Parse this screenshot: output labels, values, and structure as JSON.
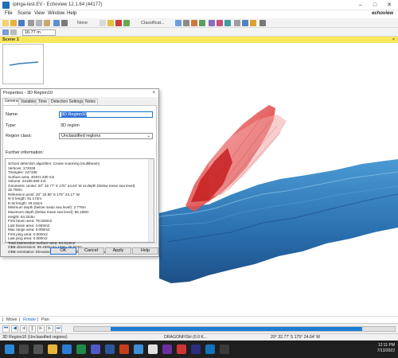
{
  "window": {
    "title": "ipinga-test.EV - Echoview 12.1.64 (44177)"
  },
  "brand": "echoview",
  "menu": [
    "File",
    "Scene",
    "View",
    "Window",
    "Help"
  ],
  "toolbar": {
    "none_label": "None",
    "classification_label": "Classificat..."
  },
  "coord_field": {
    "value": "16.77  m"
  },
  "scene": {
    "tab_label": "Scene 1",
    "close": "×"
  },
  "dialog": {
    "title": "Properties - 3D Region10",
    "close": "×",
    "tabs": [
      "General",
      "Variables",
      "Time",
      "Detection Settings",
      "Notes"
    ],
    "active_tab": "General",
    "name_label": "Name:",
    "name_value": "3D Region10",
    "type_label": "Type:",
    "type_value": "3D region",
    "class_label": "Region class:",
    "class_value": "Unclassified regions",
    "further_label": "Further information:",
    "info_lines": [
      "School detection algorithm: Cruise scanning (multibeam)",
      "Vertices: 172028",
      "Triangles: 247336",
      "Surface area:  40401.330 m2",
      "Volume:  22186.609 m3",
      "Geometric center: 20° 32.77' S 175° 24.64' W at depth (below mean sea level):",
      "32.760m",
      "Reference point: 20° 32.90' S 175° 24.17' W",
      "N-S length:   91.172m",
      "E-W length:   49.162m",
      "Minimum depth (below mean sea level):     2.776m",
      "Maximum depth (below mean sea level):     56.188m",
      "Height:  53.323m",
      "First beam area:   79.026m2",
      "Last beam area:   4.663m2",
      "Max range area:   0.000m2",
      "First ping area:   0.000m2",
      "Last ping area:   0.000m2",
      "Total intersection surface area:  84.613m2",
      "OBB dimensions:  96.469m  52.159m  36.543m",
      "OBB orientation: Elevation 24.855°, Azimuth 193.531°, Rotation 130.394°"
    ],
    "buttons": {
      "ok": "OK",
      "cancel": "Cancel",
      "apply": "Apply",
      "help": "Help"
    }
  },
  "modebar": {
    "move": "Move",
    "sep1": "|",
    "rotate": "Rotate",
    "sep2": "|",
    "pan": "Pan"
  },
  "playback": {
    "progress": 0.885
  },
  "status": {
    "left": "3D Region10 (Unclassified regions)",
    "center": "DRAGONFISH (0.0 K...",
    "coords": "20° 32.77' S 175° 24.64' W"
  },
  "clock": {
    "time": "12:11 PM",
    "date": "7/13/2022"
  },
  "colors": {
    "accent": "#1c7ed6",
    "scene_header": "#f8e85a",
    "seafloor": "#2f7fbf",
    "school": "#d63b3b"
  }
}
